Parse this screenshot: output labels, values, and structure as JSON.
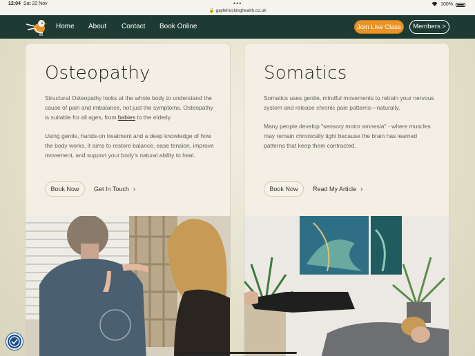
{
  "status_bar": {
    "time": "12:04",
    "date": "Sat 22 Nov",
    "url": "gaylehockinghealth.co.uk",
    "battery": "100%"
  },
  "nav": {
    "links": [
      "Home",
      "About",
      "Contact",
      "Book Online"
    ],
    "join_label": "Join Live Class",
    "members_label": "Members >",
    "colors": {
      "bar": "#1e3b33",
      "accent": "#e99328"
    }
  },
  "osteopathy": {
    "title": "Osteopathy",
    "para1_before": "Structural Osteopathy looks at the whole body to understand the cause of pain and imbalance, not just the symptoms. Osteopathy is suitable for all ages, from ",
    "para1_link": "babies",
    "para1_after": " to the elderly.",
    "para2": "Using gentle, hands-on treatment and a deep knowledge of how the body works, it aims to restore balance, ease tension, improve movement, and support your body’s natural ability to heal.",
    "book_label": "Book Now",
    "secondary_label": "Get In Touch"
  },
  "somatics": {
    "title": "Somatics",
    "para1": "Somatics uses gentle, mindful movements to retrain your nervous system and release chronic pain patterns—naturally.",
    "para2": "Many people develop \"sensory motor amnesia\" - where muscles may remain chronically tight because the brain has learned patterns that keep them contracted.",
    "book_label": "Book Now",
    "secondary_label": "Read My Article"
  },
  "icons": {
    "logo": "bird-logo-icon",
    "accessibility": "accessibility-icon",
    "chevron": "chevron-right-icon"
  }
}
